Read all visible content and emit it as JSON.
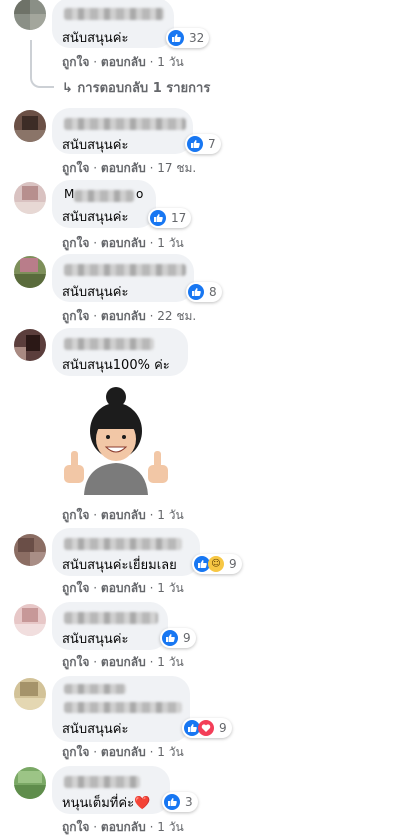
{
  "actions": {
    "like": "ถูกใจ",
    "reply": "ตอบกลับ",
    "sep": "·"
  },
  "comments": [
    {
      "text": "สนับสนุนค่ะ",
      "reactions": "32",
      "time": "1 วัน"
    },
    {
      "text": "สนับสนุนค่ะ",
      "reactions": "7",
      "time": "17 ชม."
    },
    {
      "name_partial": "M",
      "name_partial_end": "o",
      "text": "สนับสนุนค่ะ",
      "reactions": "17",
      "time": "1 วัน"
    },
    {
      "text": "สนับสนุนค่ะ",
      "reactions": "8",
      "time": "22 ชม."
    },
    {
      "text": "สนับสนุน100% ค่ะ",
      "time": "1 วัน"
    },
    {
      "text": "สนับสนุนค่ะเยี่ยมเลย",
      "reactions": "9",
      "time": "1 วัน"
    },
    {
      "text": "สนับสนุนค่ะ",
      "reactions": "9",
      "time": "1 วัน"
    },
    {
      "text": "สนับสนุนค่ะ",
      "reactions": "9",
      "time": "1 วัน"
    },
    {
      "text": "หนุนเต็มที่ค่ะ❤️",
      "reactions": "3",
      "time": "1 วัน"
    }
  ],
  "replies_link": "↳ การตอบกลับ 1 รายการ",
  "colors": {
    "bubble": "#f0f2f5",
    "like_blue": "#1877f2",
    "meta_gray": "#65676b"
  }
}
